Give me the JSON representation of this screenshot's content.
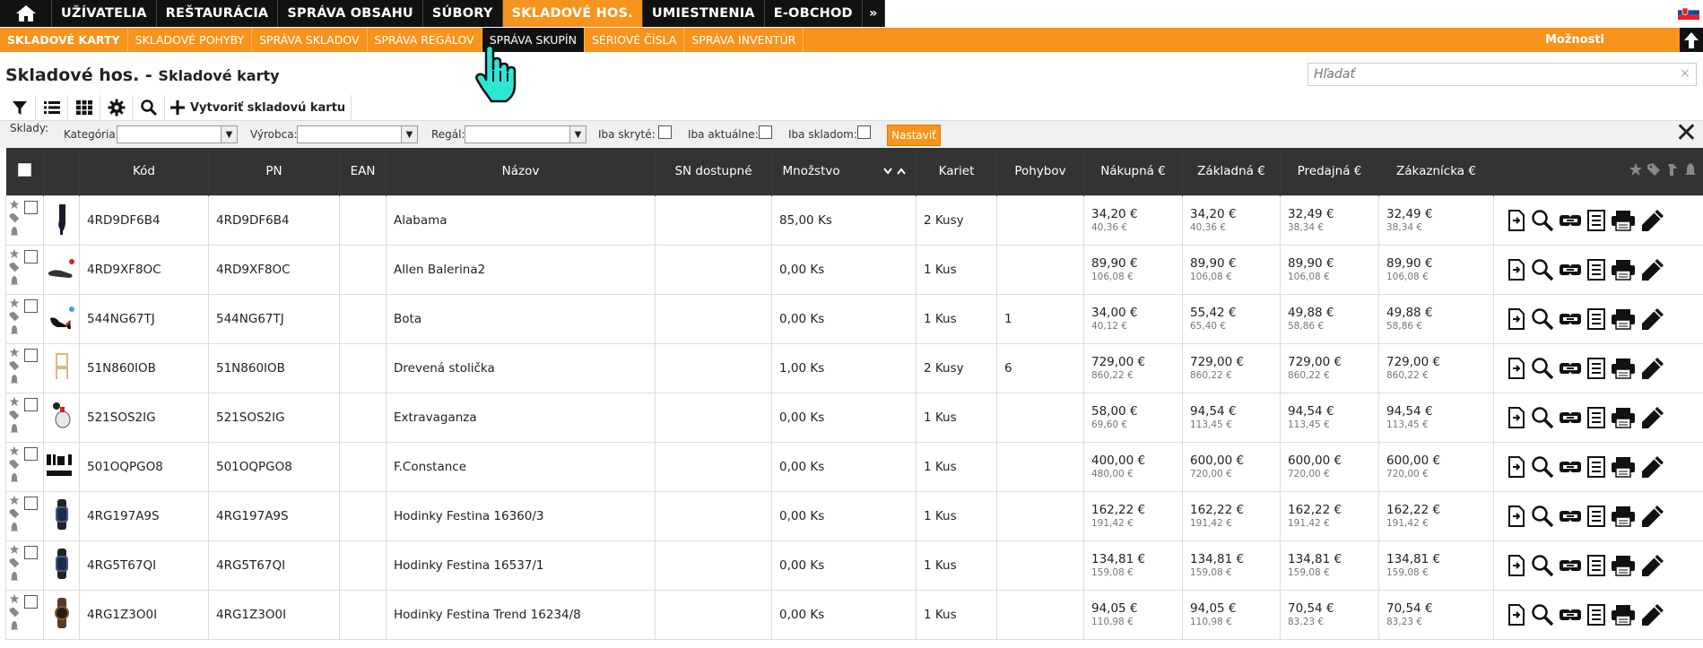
{
  "topnav": {
    "items": [
      "UŽÍVATELIA",
      "REŠTAURÁCIA",
      "SPRÁVA OBSAHU",
      "SÚBORY",
      "SKLADOVÉ HOS.",
      "UMIESTNENIA",
      "E-OBCHOD"
    ],
    "more": "»",
    "active_index": 4
  },
  "subnav": {
    "items": [
      "SKLADOVÉ KARTY",
      "SKLADOVÉ POHYBY",
      "SPRÁVA SKLADOV",
      "SPRÁVA REGÁLOV",
      "SPRÁVA SKUPÍN",
      "SÉRIOVÉ ČÍSLA",
      "SPRÁVA INVENTÚR"
    ],
    "options_label": "Možnosti"
  },
  "header": {
    "title_main": "Skladové hos. - ",
    "title_sub": "Skladové karty",
    "search_placeholder": "Hľadať",
    "search_clear": "×"
  },
  "toolbar": {
    "create_label": "Vytvoriť skladovú kartu"
  },
  "filter": {
    "sklady_label": "Sklady:",
    "kategoria_label": "Kategória:",
    "vyrobca_label": "Výrobca:",
    "regal_label": "Regál:",
    "iba_skryte_label": "Iba skryté:",
    "iba_aktualne_label": "Iba aktuálne:",
    "iba_skladom_label": "Iba skladom:",
    "set_button": "Nastaviť",
    "close_symbol": "✕"
  },
  "table": {
    "columns": [
      "Kód",
      "PN",
      "EAN",
      "Názov",
      "SN dostupné",
      "Množstvo",
      "Kariet",
      "Pohybov",
      "Nákupná €",
      "Základná €",
      "Predajná €",
      "Zákaznícka €"
    ],
    "rows": [
      {
        "kod": "4RD9DF6B4",
        "pn": "4RD9DF6B4",
        "ean": "",
        "nazov": "Alabama",
        "sn": "",
        "mnozstvo": "85,00 Ks",
        "kariet": "2 Kusy",
        "pohybov": "",
        "nakupna": "34,20 €",
        "nakupna_sub": "40,36 €",
        "zakladna": "34,20 €",
        "zakladna_sub": "40,36 €",
        "predajna": "32,49 €",
        "predajna_sub": "38,34 €",
        "zakaznicka": "32,49 €",
        "zakaznicka_sub": "38,34 €",
        "thumb": "boot"
      },
      {
        "kod": "4RD9XF8OC",
        "pn": "4RD9XF8OC",
        "ean": "",
        "nazov": "Allen Balerina2",
        "sn": "",
        "mnozstvo": "0,00 Ks",
        "kariet": "1 Kus",
        "pohybov": "",
        "nakupna": "89,90 €",
        "nakupna_sub": "106,08 €",
        "zakladna": "89,90 €",
        "zakladna_sub": "106,08 €",
        "predajna": "89,90 €",
        "predajna_sub": "106,08 €",
        "zakaznicka": "89,90 €",
        "zakaznicka_sub": "106,08 €",
        "thumb": "flat-shoe"
      },
      {
        "kod": "544NG67TJ",
        "pn": "544NG67TJ",
        "ean": "",
        "nazov": "Bota",
        "sn": "",
        "mnozstvo": "0,00 Ks",
        "kariet": "1 Kus",
        "pohybov": "1",
        "nakupna": "34,00 €",
        "nakupna_sub": "40,12 €",
        "zakladna": "55,42 €",
        "zakladna_sub": "65,40 €",
        "predajna": "49,88 €",
        "predajna_sub": "58,86 €",
        "zakaznicka": "49,88 €",
        "zakaznicka_sub": "58,86 €",
        "thumb": "heel"
      },
      {
        "kod": "51N860IOB",
        "pn": "51N860IOB",
        "ean": "",
        "nazov": "Drevená stolička",
        "sn": "",
        "mnozstvo": "1,00 Ks",
        "kariet": "2 Kusy",
        "pohybov": "6",
        "nakupna": "729,00 €",
        "nakupna_sub": "860,22 €",
        "zakladna": "729,00 €",
        "zakladna_sub": "860,22 €",
        "predajna": "729,00 €",
        "predajna_sub": "860,22 €",
        "zakaznicka": "729,00 €",
        "zakaznicka_sub": "860,22 €",
        "thumb": "chair"
      },
      {
        "kod": "521SOS2IG",
        "pn": "521SOS2IG",
        "ean": "",
        "nazov": "Extravaganza",
        "sn": "",
        "mnozstvo": "0,00 Ks",
        "kariet": "1 Kus",
        "pohybov": "",
        "nakupna": "58,00 €",
        "nakupna_sub": "69,60 €",
        "zakladna": "94,54 €",
        "zakladna_sub": "113,45 €",
        "predajna": "94,54 €",
        "predajna_sub": "113,45 €",
        "zakaznicka": "94,54 €",
        "zakaznicka_sub": "113,45 €",
        "thumb": "perfume"
      },
      {
        "kod": "501OQPGO8",
        "pn": "501OQPGO8",
        "ean": "",
        "nazov": "F.Constance",
        "sn": "",
        "mnozstvo": "0,00 Ks",
        "kariet": "1 Kus",
        "pohybov": "",
        "nakupna": "400,00 €",
        "nakupna_sub": "480,00 €",
        "zakladna": "600,00 €",
        "zakladna_sub": "720,00 €",
        "predajna": "600,00 €",
        "predajna_sub": "720,00 €",
        "zakaznicka": "600,00 €",
        "zakaznicka_sub": "720,00 €",
        "thumb": "text-logo"
      },
      {
        "kod": "4RG197A9S",
        "pn": "4RG197A9S",
        "ean": "",
        "nazov": "Hodinky Festina 16360/3",
        "sn": "",
        "mnozstvo": "0,00 Ks",
        "kariet": "1 Kus",
        "pohybov": "",
        "nakupna": "162,22 €",
        "nakupna_sub": "191,42 €",
        "zakladna": "162,22 €",
        "zakladna_sub": "191,42 €",
        "predajna": "162,22 €",
        "predajna_sub": "191,42 €",
        "zakaznicka": "162,22 €",
        "zakaznicka_sub": "191,42 €",
        "thumb": "watch"
      },
      {
        "kod": "4RG5T67QI",
        "pn": "4RG5T67QI",
        "ean": "",
        "nazov": "Hodinky Festina 16537/1",
        "sn": "",
        "mnozstvo": "0,00 Ks",
        "kariet": "1 Kus",
        "pohybov": "",
        "nakupna": "134,81 €",
        "nakupna_sub": "159,08 €",
        "zakladna": "134,81 €",
        "zakladna_sub": "159,08 €",
        "predajna": "134,81 €",
        "predajna_sub": "159,08 €",
        "zakaznicka": "134,81 €",
        "zakaznicka_sub": "159,08 €",
        "thumb": "watch"
      },
      {
        "kod": "4RG1Z3O0I",
        "pn": "4RG1Z3O0I",
        "ean": "",
        "nazov": "Hodinky Festina Trend 16234/8",
        "sn": "",
        "mnozstvo": "0,00 Ks",
        "kariet": "1 Kus",
        "pohybov": "",
        "nakupna": "94,05 €",
        "nakupna_sub": "110,98 €",
        "zakladna": "94,05 €",
        "zakladna_sub": "110,98 €",
        "predajna": "70,54 €",
        "predajna_sub": "83,23 €",
        "zakaznicka": "70,54 €",
        "zakaznicka_sub": "83,23 €",
        "thumb": "watch-brown"
      }
    ]
  },
  "colors": {
    "accent": "#f7941d",
    "dark": "#111111",
    "header_row": "#333333"
  }
}
